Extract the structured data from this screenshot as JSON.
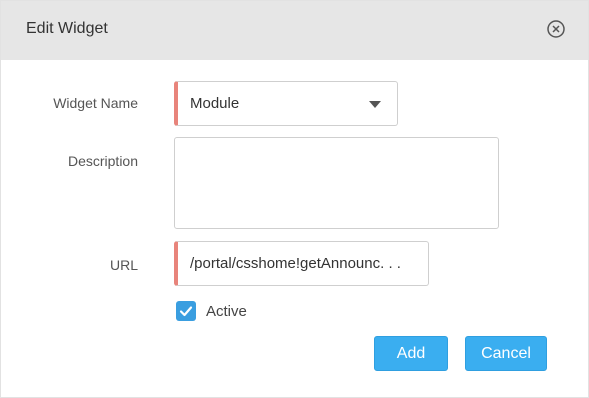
{
  "dialog": {
    "title": "Edit Widget"
  },
  "form": {
    "widget_name": {
      "label": "Widget Name",
      "value": "Module"
    },
    "description": {
      "label": "Description",
      "value": ""
    },
    "url": {
      "label": "URL",
      "value": "/portal/csshome!getAnnounc. . ."
    },
    "active": {
      "label": "Active",
      "checked": true
    }
  },
  "buttons": {
    "add": "Add",
    "cancel": "Cancel"
  },
  "colors": {
    "header_bg": "#e6e6e6",
    "required_marker": "#e8847b",
    "primary_button": "#3aaef0",
    "checkbox": "#3a9ee0"
  },
  "icons": {
    "close": "close-circle-icon",
    "dropdown": "caret-down-icon",
    "checkbox": "checkmark-icon"
  }
}
